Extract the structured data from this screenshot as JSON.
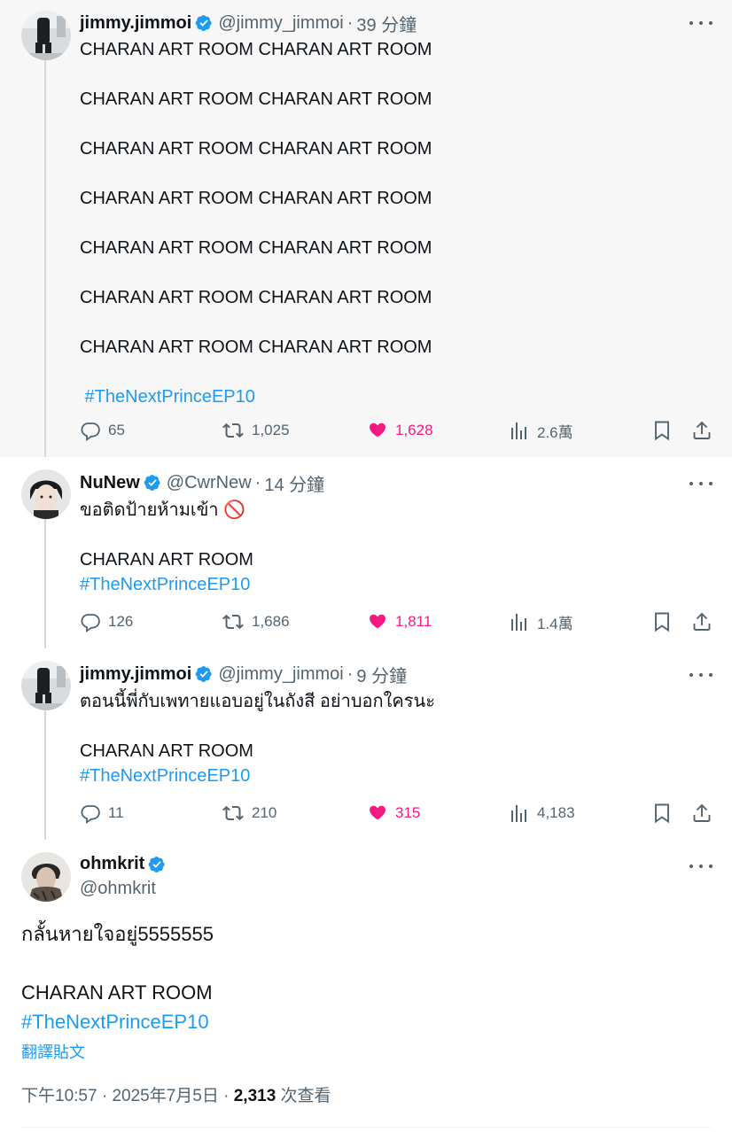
{
  "replies": [
    {
      "name": "jimmy.jimmoi",
      "handle": "@jimmy_jimmoi",
      "sep": "·",
      "time": "39 分鐘",
      "lines": [
        "CHARAN ART ROOM CHARAN ART ROOM",
        "",
        "CHARAN ART ROOM CHARAN ART ROOM",
        "",
        "CHARAN ART ROOM CHARAN ART ROOM",
        "",
        "CHARAN ART ROOM CHARAN ART ROOM",
        "",
        "CHARAN ART ROOM CHARAN ART ROOM",
        "",
        "CHARAN ART ROOM CHARAN ART ROOM",
        "",
        "CHARAN ART ROOM CHARAN ART ROOM",
        ""
      ],
      "hashtag": " #TheNextPrinceEP10",
      "replies": "65",
      "reposts": "1,025",
      "likes": "1,628",
      "views": "2.6萬"
    },
    {
      "name": "NuNew",
      "handle": "@CwrNew",
      "sep": "·",
      "time": "14 分鐘",
      "lines": [
        "ขอติดป้ายห้ามเข้า 🚫",
        "",
        "CHARAN ART ROOM"
      ],
      "hashtag": "#TheNextPrinceEP10",
      "replies": "126",
      "reposts": "1,686",
      "likes": "1,811",
      "views": "1.4萬"
    },
    {
      "name": "jimmy.jimmoi",
      "handle": "@jimmy_jimmoi",
      "sep": "·",
      "time": "9 分鐘",
      "lines": [
        "ตอนนี้พี่กับเพทายแอบอยู่ในถังสี อย่าบอกใครนะ",
        "",
        "CHARAN ART ROOM"
      ],
      "hashtag": "#TheNextPrinceEP10",
      "replies": "11",
      "reposts": "210",
      "likes": "315",
      "views": "4,183"
    }
  ],
  "main": {
    "name": "ohmkrit",
    "handle": "@ohmkrit",
    "lines": [
      "กลั้นหายใจอยู่5555555",
      "",
      "CHARAN ART ROOM"
    ],
    "hashtag": "#TheNextPrinceEP10",
    "translate": "翻譯貼文",
    "time": "下午10:57",
    "sep": "·",
    "date": "2025年7月5日",
    "sep2": "·",
    "views_count": "2,313",
    "views_label": " 次查看"
  },
  "colors": {
    "accent": "#1d9bf0",
    "like": "#f91880",
    "muted": "#536471",
    "highlight_bg": "#f7f7f7"
  }
}
